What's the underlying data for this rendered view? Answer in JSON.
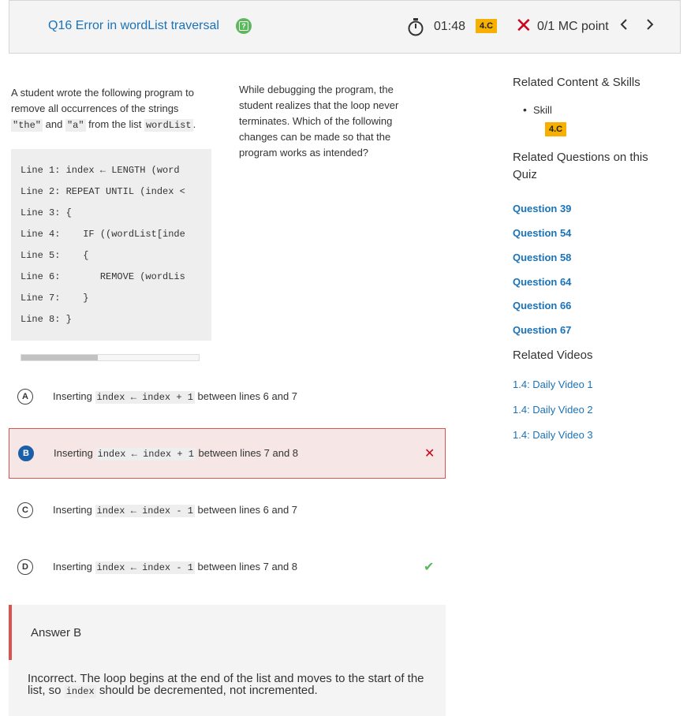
{
  "header": {
    "title": "Q16 Error in wordList traversal",
    "help_glyph": "?",
    "timer": "01:48",
    "skill_badge": "4.C",
    "score": "0/1 MC point",
    "prev_glyph": "‹",
    "next_glyph": "›"
  },
  "stimulus": {
    "left": {
      "p1": "A student wrote the following program to remove all occurrences of the strings ",
      "code_the": "\"the\"",
      "and_text": " and ",
      "code_a": "\"a\"",
      "p2": " from the list ",
      "code_list": "wordList",
      "p3": "."
    },
    "code_lines": [
      "Line 1: index ← LENGTH (word",
      "Line 2: REPEAT UNTIL (index <",
      "Line 3: {",
      "Line 4:    IF ((wordList[inde",
      "Line 5:    {",
      "Line 6:       REMOVE (wordLis",
      "Line 7:    }",
      "Line 8: }"
    ],
    "scroll_fraction": 0.43,
    "right_text": "While debugging the program, the student realizes that the loop never terminates. Which of the following changes can be made so that the program works as intended?"
  },
  "options": [
    {
      "letter": "A",
      "prefix": "Inserting",
      "code": "index ← index + 1",
      "suffix": "between lines 6 and 7",
      "state": "none"
    },
    {
      "letter": "B",
      "prefix": "Inserting",
      "code": "index ← index + 1",
      "suffix": "between lines 7 and 8",
      "state": "selected-wrong",
      "mark": "✕"
    },
    {
      "letter": "C",
      "prefix": "Inserting",
      "code": "index ← index - 1",
      "suffix": "between lines 6 and 7",
      "state": "none"
    },
    {
      "letter": "D",
      "prefix": "Inserting",
      "code": "index ← index - 1",
      "suffix": "between lines 7 and 8",
      "state": "correct",
      "mark": "✔"
    }
  ],
  "answer": {
    "label": "Answer B",
    "expl_1": "Incorrect. The loop begins at the end of the list and moves to the start of the list, so ",
    "expl_code": "index",
    "expl_2": " should be decremented, not incremented."
  },
  "sidebar": {
    "related_heading": "Related Content & Skills",
    "skill_label": "Skill",
    "skill_badge": "4.C",
    "questions_heading": "Related Questions on this Quiz",
    "questions": [
      "Question 39",
      "Question 54",
      "Question 58",
      "Question 64",
      "Question 66",
      "Question 67"
    ],
    "videos_heading": "Related Videos",
    "videos": [
      "1.4: Daily Video 1",
      "1.4: Daily Video 2",
      "1.4: Daily Video 3"
    ]
  },
  "colors": {
    "link": "#1a73b8",
    "badge": "#f7b000",
    "wrong": "#d0021b",
    "correct": "#5cb85c",
    "selected_bg": "#f7e6e6"
  }
}
